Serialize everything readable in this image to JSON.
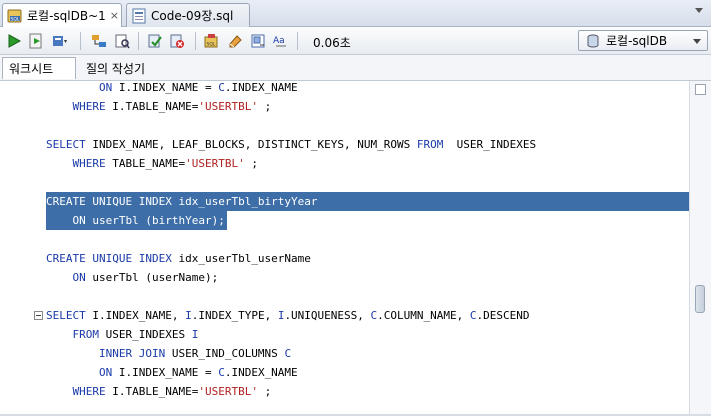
{
  "tabs": [
    {
      "label": "로컬-sqlDB~1",
      "active": true,
      "icon": "sql-worksheet-icon",
      "close": "×"
    },
    {
      "label": "Code-09장.sql",
      "active": false,
      "icon": "sql-file-icon"
    }
  ],
  "toolbar": {
    "elapsed": "0.06초",
    "connection": "로컬-sqlDB",
    "icons": [
      "run-statement-icon",
      "run-script-icon",
      "autotrace-icon",
      "explain-plan-icon",
      "sql-tuning-icon",
      "commit-icon",
      "rollback-icon",
      "unshared-worksheet-icon",
      "clear-icon",
      "history-icon",
      "format-case-icon"
    ]
  },
  "subtabs": [
    "워크시트",
    "질의 작성기"
  ],
  "colors": {
    "selection": "#3d6ea8",
    "keyword": "#1a3aa8",
    "string": "#b02020"
  },
  "code": [
    {
      "t": [
        [
          "",
          "        "
        ],
        [
          "kw",
          "ON"
        ],
        [
          "",
          " I.INDEX_NAME = "
        ],
        [
          "kw",
          "C"
        ],
        [
          "",
          ".INDEX_NAME"
        ]
      ]
    },
    {
      "t": [
        [
          "",
          "    "
        ],
        [
          "kw",
          "WHERE"
        ],
        [
          "",
          " I.TABLE_NAME="
        ],
        [
          "str",
          "'USERTBL'"
        ],
        [
          "",
          " ;"
        ]
      ]
    },
    {
      "t": []
    },
    {
      "t": [
        [
          "kw",
          "SELECT"
        ],
        [
          "",
          " INDEX_NAME, LEAF_BLOCKS, DISTINCT_KEYS, NUM_ROWS "
        ],
        [
          "kw",
          "FROM"
        ],
        [
          "",
          "  USER_INDEXES"
        ]
      ]
    },
    {
      "t": [
        [
          "",
          "    "
        ],
        [
          "kw",
          "WHERE"
        ],
        [
          "",
          " TABLE_NAME="
        ],
        [
          "str",
          "'USERTBL'"
        ],
        [
          "",
          " ;"
        ]
      ]
    },
    {
      "t": []
    },
    {
      "t": [
        [
          "kw",
          "CREATE UNIQUE INDEX"
        ],
        [
          "",
          " idx_userTbl_birtyYear"
        ]
      ],
      "sel": true,
      "full": true
    },
    {
      "t": [
        [
          "",
          "    "
        ],
        [
          "kw",
          "ON"
        ],
        [
          "",
          " userTbl (birthYear);"
        ]
      ],
      "sel": true
    },
    {
      "t": []
    },
    {
      "t": [
        [
          "kw",
          "CREATE UNIQUE INDEX"
        ],
        [
          "",
          " idx_userTbl_userName"
        ]
      ]
    },
    {
      "t": [
        [
          "",
          "    "
        ],
        [
          "kw",
          "ON"
        ],
        [
          "",
          " userTbl (userName);"
        ]
      ]
    },
    {
      "t": []
    },
    {
      "t": [
        [
          "kw",
          "SELECT"
        ],
        [
          "",
          " I.INDEX_NAME, "
        ],
        [
          "kw",
          "I"
        ],
        [
          "",
          ".INDEX_TYPE, "
        ],
        [
          "kw",
          "I"
        ],
        [
          "",
          ".UNIQUENESS, "
        ],
        [
          "kw",
          "C"
        ],
        [
          "",
          ".COLUMN_NAME, "
        ],
        [
          "kw",
          "C"
        ],
        [
          "",
          ".DESCEND"
        ]
      ],
      "fold": true
    },
    {
      "t": [
        [
          "",
          "    "
        ],
        [
          "kw",
          "FROM"
        ],
        [
          "",
          " USER_INDEXES "
        ],
        [
          "kw",
          "I"
        ]
      ]
    },
    {
      "t": [
        [
          "",
          "        "
        ],
        [
          "kw",
          "INNER JOIN"
        ],
        [
          "",
          " USER_IND_COLUMNS "
        ],
        [
          "kw",
          "C"
        ]
      ]
    },
    {
      "t": [
        [
          "",
          "        "
        ],
        [
          "kw",
          "ON"
        ],
        [
          "",
          " I.INDEX_NAME = "
        ],
        [
          "kw",
          "C"
        ],
        [
          "",
          ".INDEX_NAME"
        ]
      ]
    },
    {
      "t": [
        [
          "",
          "    "
        ],
        [
          "kw",
          "WHERE"
        ],
        [
          "",
          " I.TABLE_NAME="
        ],
        [
          "str",
          "'USERTBL'"
        ],
        [
          "",
          " ;"
        ]
      ]
    }
  ]
}
